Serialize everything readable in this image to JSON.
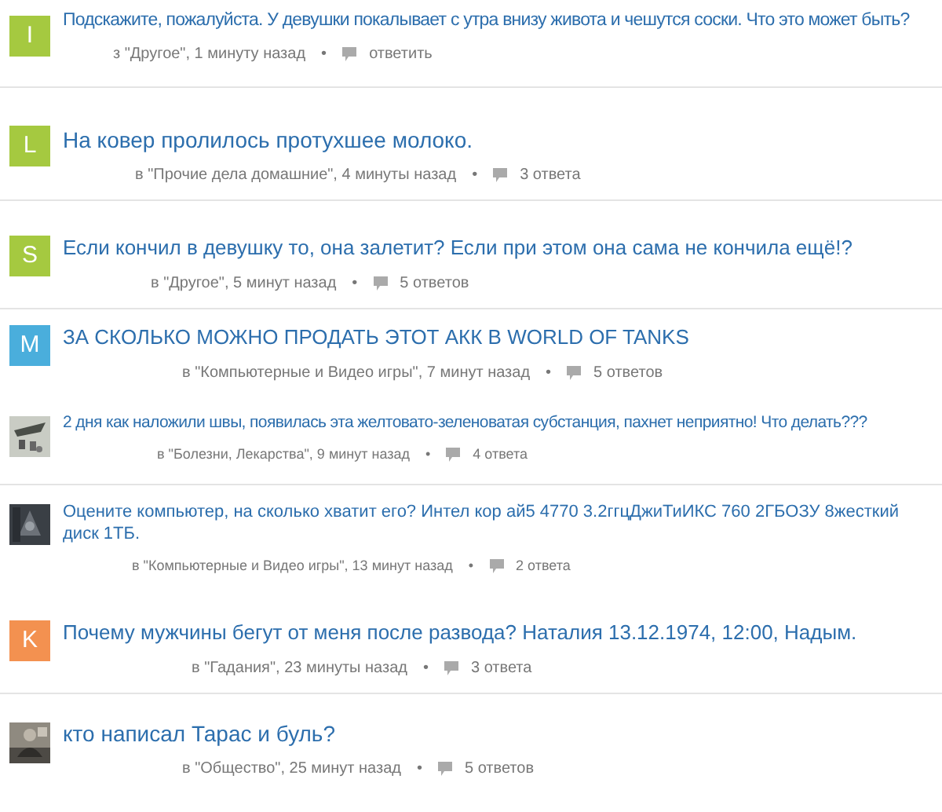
{
  "questions": [
    {
      "avatar": {
        "kind": "letter",
        "letter": "I",
        "color": "#a5c940"
      },
      "title": "Подскажите, пожалуйста. У девушки покалывает с утра внизу живота и чешутся соски. Что это может быть?",
      "category": "з \"Другое\", 1 минуту назад",
      "separator": "•",
      "answers": "ответить",
      "divider": true
    },
    {
      "avatar": {
        "kind": "letter",
        "letter": "L",
        "color": "#a5c940"
      },
      "title": "На ковер пролилось протухшее молоко.",
      "category": "в \"Прочие дела домашние\", 4 минуты назад",
      "separator": "•",
      "answers": "3 ответа",
      "divider": true
    },
    {
      "avatar": {
        "kind": "letter",
        "letter": "S",
        "color": "#a5c940"
      },
      "title": "Если кончил в девушку то, она залетит? Если при этом она сама не кончила ещё!?",
      "category": "в \"Другое\", 5 минут назад",
      "separator": "•",
      "answers": "5 ответов",
      "divider": true
    },
    {
      "avatar": {
        "kind": "letter",
        "letter": "M",
        "color": "#4aaedc"
      },
      "title": "ЗА СКОЛЬКО МОЖНО ПРОДАТЬ ЭТОТ АКК В WORLD OF TANKS",
      "category": "в \"Компьютерные и Видео игры\", 7 минут назад",
      "separator": "•",
      "answers": "5 ответов",
      "divider": false
    },
    {
      "title": "2 дня как наложили швы, появилась эта желтовато-зеленоватая субстанция, пахнет неприятно! Что делать???",
      "category": "в \"Болезни, Лекарства\", 9 минут назад",
      "separator": "•",
      "answers": "4 ответа",
      "divider": true
    },
    {
      "title": "Оцените компьютер, на сколько хватит его? Интел кор ай5 4770 3.2ггцДжиТиИКС 760 2ГБОЗУ 8жесткий диск 1ТБ.",
      "category": "в \"Компьютерные и Видео игры\", 13 минут назад",
      "separator": "•",
      "answers": "2 ответа",
      "divider": false
    },
    {
      "avatar": {
        "kind": "letter",
        "letter": "K",
        "color": "#f39150"
      },
      "title": "Почему мужчины бегут от меня после развода? Наталия 13.12.1974, 12:00, Надым.",
      "category": "в \"Гадания\", 23 минуты назад",
      "separator": "•",
      "answers": "3 ответа",
      "divider": true
    },
    {
      "title": "кто написал Тарас и буль?",
      "category": "в \"Общество\", 25 минут назад",
      "separator": "•",
      "answers": "5 ответов",
      "divider": false
    }
  ]
}
